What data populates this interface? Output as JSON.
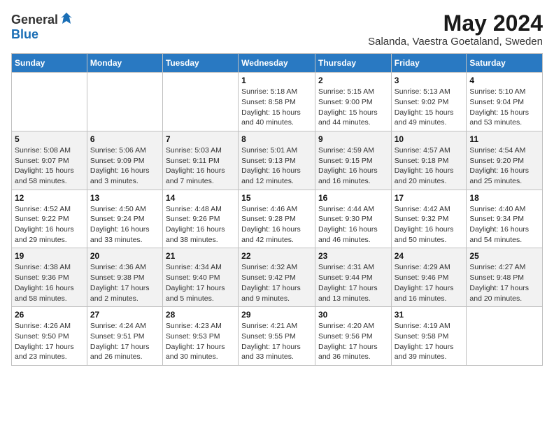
{
  "logo": {
    "text_general": "General",
    "text_blue": "Blue"
  },
  "title": "May 2024",
  "subtitle": "Salanda, Vaestra Goetaland, Sweden",
  "days_of_week": [
    "Sunday",
    "Monday",
    "Tuesday",
    "Wednesday",
    "Thursday",
    "Friday",
    "Saturday"
  ],
  "weeks": [
    [
      {
        "day": "",
        "info": ""
      },
      {
        "day": "",
        "info": ""
      },
      {
        "day": "",
        "info": ""
      },
      {
        "day": "1",
        "info": "Sunrise: 5:18 AM\nSunset: 8:58 PM\nDaylight: 15 hours\nand 40 minutes."
      },
      {
        "day": "2",
        "info": "Sunrise: 5:15 AM\nSunset: 9:00 PM\nDaylight: 15 hours\nand 44 minutes."
      },
      {
        "day": "3",
        "info": "Sunrise: 5:13 AM\nSunset: 9:02 PM\nDaylight: 15 hours\nand 49 minutes."
      },
      {
        "day": "4",
        "info": "Sunrise: 5:10 AM\nSunset: 9:04 PM\nDaylight: 15 hours\nand 53 minutes."
      }
    ],
    [
      {
        "day": "5",
        "info": "Sunrise: 5:08 AM\nSunset: 9:07 PM\nDaylight: 15 hours\nand 58 minutes."
      },
      {
        "day": "6",
        "info": "Sunrise: 5:06 AM\nSunset: 9:09 PM\nDaylight: 16 hours\nand 3 minutes."
      },
      {
        "day": "7",
        "info": "Sunrise: 5:03 AM\nSunset: 9:11 PM\nDaylight: 16 hours\nand 7 minutes."
      },
      {
        "day": "8",
        "info": "Sunrise: 5:01 AM\nSunset: 9:13 PM\nDaylight: 16 hours\nand 12 minutes."
      },
      {
        "day": "9",
        "info": "Sunrise: 4:59 AM\nSunset: 9:15 PM\nDaylight: 16 hours\nand 16 minutes."
      },
      {
        "day": "10",
        "info": "Sunrise: 4:57 AM\nSunset: 9:18 PM\nDaylight: 16 hours\nand 20 minutes."
      },
      {
        "day": "11",
        "info": "Sunrise: 4:54 AM\nSunset: 9:20 PM\nDaylight: 16 hours\nand 25 minutes."
      }
    ],
    [
      {
        "day": "12",
        "info": "Sunrise: 4:52 AM\nSunset: 9:22 PM\nDaylight: 16 hours\nand 29 minutes."
      },
      {
        "day": "13",
        "info": "Sunrise: 4:50 AM\nSunset: 9:24 PM\nDaylight: 16 hours\nand 33 minutes."
      },
      {
        "day": "14",
        "info": "Sunrise: 4:48 AM\nSunset: 9:26 PM\nDaylight: 16 hours\nand 38 minutes."
      },
      {
        "day": "15",
        "info": "Sunrise: 4:46 AM\nSunset: 9:28 PM\nDaylight: 16 hours\nand 42 minutes."
      },
      {
        "day": "16",
        "info": "Sunrise: 4:44 AM\nSunset: 9:30 PM\nDaylight: 16 hours\nand 46 minutes."
      },
      {
        "day": "17",
        "info": "Sunrise: 4:42 AM\nSunset: 9:32 PM\nDaylight: 16 hours\nand 50 minutes."
      },
      {
        "day": "18",
        "info": "Sunrise: 4:40 AM\nSunset: 9:34 PM\nDaylight: 16 hours\nand 54 minutes."
      }
    ],
    [
      {
        "day": "19",
        "info": "Sunrise: 4:38 AM\nSunset: 9:36 PM\nDaylight: 16 hours\nand 58 minutes."
      },
      {
        "day": "20",
        "info": "Sunrise: 4:36 AM\nSunset: 9:38 PM\nDaylight: 17 hours\nand 2 minutes."
      },
      {
        "day": "21",
        "info": "Sunrise: 4:34 AM\nSunset: 9:40 PM\nDaylight: 17 hours\nand 5 minutes."
      },
      {
        "day": "22",
        "info": "Sunrise: 4:32 AM\nSunset: 9:42 PM\nDaylight: 17 hours\nand 9 minutes."
      },
      {
        "day": "23",
        "info": "Sunrise: 4:31 AM\nSunset: 9:44 PM\nDaylight: 17 hours\nand 13 minutes."
      },
      {
        "day": "24",
        "info": "Sunrise: 4:29 AM\nSunset: 9:46 PM\nDaylight: 17 hours\nand 16 minutes."
      },
      {
        "day": "25",
        "info": "Sunrise: 4:27 AM\nSunset: 9:48 PM\nDaylight: 17 hours\nand 20 minutes."
      }
    ],
    [
      {
        "day": "26",
        "info": "Sunrise: 4:26 AM\nSunset: 9:50 PM\nDaylight: 17 hours\nand 23 minutes."
      },
      {
        "day": "27",
        "info": "Sunrise: 4:24 AM\nSunset: 9:51 PM\nDaylight: 17 hours\nand 26 minutes."
      },
      {
        "day": "28",
        "info": "Sunrise: 4:23 AM\nSunset: 9:53 PM\nDaylight: 17 hours\nand 30 minutes."
      },
      {
        "day": "29",
        "info": "Sunrise: 4:21 AM\nSunset: 9:55 PM\nDaylight: 17 hours\nand 33 minutes."
      },
      {
        "day": "30",
        "info": "Sunrise: 4:20 AM\nSunset: 9:56 PM\nDaylight: 17 hours\nand 36 minutes."
      },
      {
        "day": "31",
        "info": "Sunrise: 4:19 AM\nSunset: 9:58 PM\nDaylight: 17 hours\nand 39 minutes."
      },
      {
        "day": "",
        "info": ""
      }
    ]
  ]
}
